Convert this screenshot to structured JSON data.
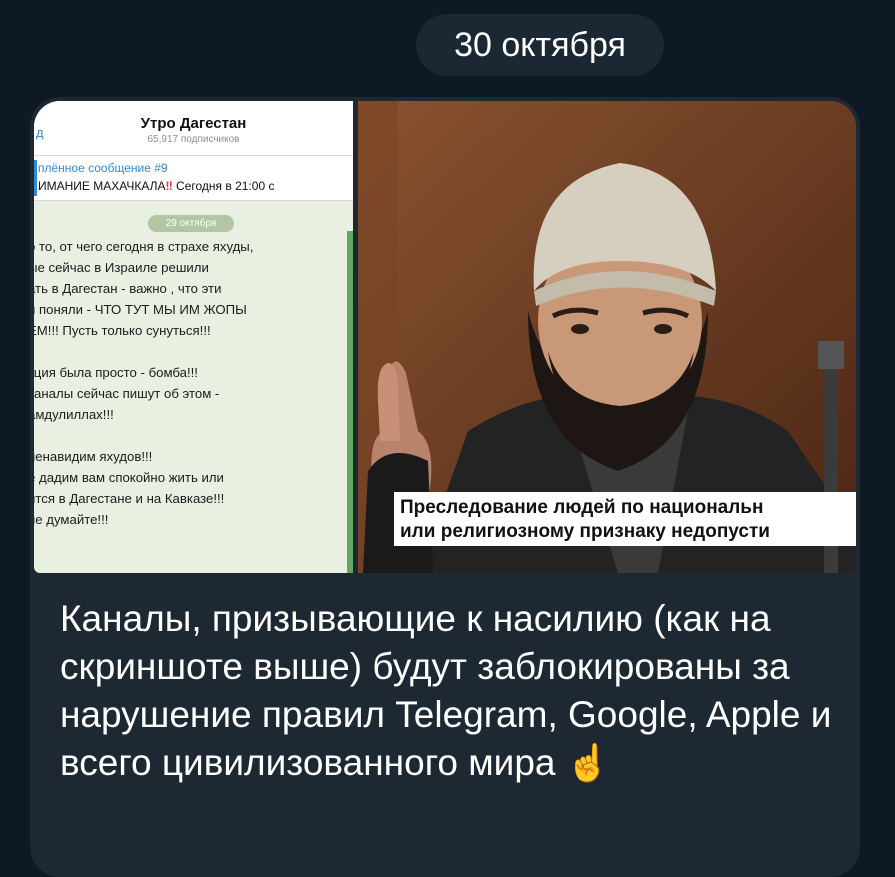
{
  "date_chip": "30 октября",
  "screenshot": {
    "back_label": "д",
    "channel_title": "Утро Дагестан",
    "subscribers": "65,917 подписчиков",
    "pinned_label": "плённое сообщение #9",
    "pinned_text_prefix": "ИМАНИЕ МАХАЧКАЛА",
    "pinned_text_alert": "‼",
    "pinned_text_suffix": " Сегодня в 21:00 с",
    "day_chip": "29 октября",
    "message_paragraphs": [
      [
        "о то, от чего сегодня в страхе яхуды,",
        "ые сейчас в Израиле решили",
        "ать в Дагестан - важно , что эти",
        "и поняли - ЧТО ТУТ МЫ ИМ ЖОПЫ",
        "ЕМ!!! Пусть только сунуться!!!"
      ],
      [
        "кция была просто - бомба!!!",
        " каналы сейчас пишут об этом -",
        "амдулиллах!!!"
      ],
      [
        "ненавидим яхудов!!!",
        "е дадим вам спокойно жить или",
        "ится в Дагестане и на Кавказе!!!",
        " не думайте!!!"
      ]
    ]
  },
  "photo": {
    "caption_line1": "Преследование людей по национальн",
    "caption_line2": "или религиозному признаку недопусти"
  },
  "message": {
    "text": "Каналы, призывающие к насилию (как на скриншоте выше) будут заблокированы за нарушение правил Telegram, Google, Apple и всего цивилизованного мира",
    "emoji": "☝️"
  },
  "colors": {
    "background": "#0f1923",
    "bubble": "#1d2833",
    "link_blue": "#2f8bd8",
    "alert_red": "#e53935"
  }
}
